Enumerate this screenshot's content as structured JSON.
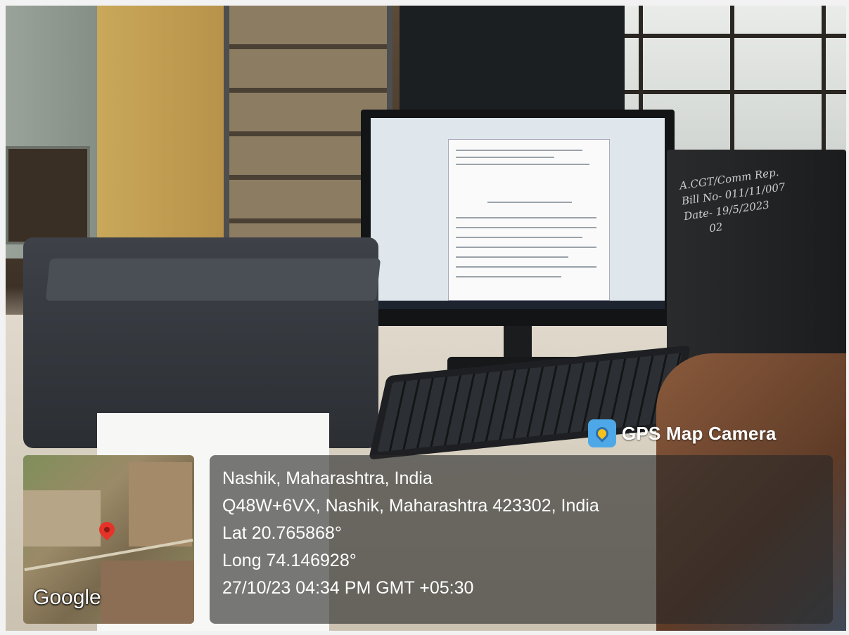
{
  "watermark": {
    "brand_icon": "gps-map-camera-icon",
    "brand_label": "GPS Map Camera"
  },
  "location": {
    "place": "Nashik, Maharashtra, India",
    "address": "Q48W+6VX, Nashik, Maharashtra 423302, India",
    "latitude": "Lat 20.765868°",
    "longitude": "Long 74.146928°",
    "timestamp": "27/10/23 04:34 PM GMT +05:30"
  },
  "map": {
    "provider": "Google",
    "pin_icon": "map-pin-icon"
  },
  "handwritten_note": "A.CGT/Comm Rep. Bill No- 011/11/007 Date- 19/5/2023 02",
  "colors": {
    "overlay_bg": "#282828",
    "pin_red": "#e5332a",
    "brand_blue": "#4ea8e8"
  }
}
